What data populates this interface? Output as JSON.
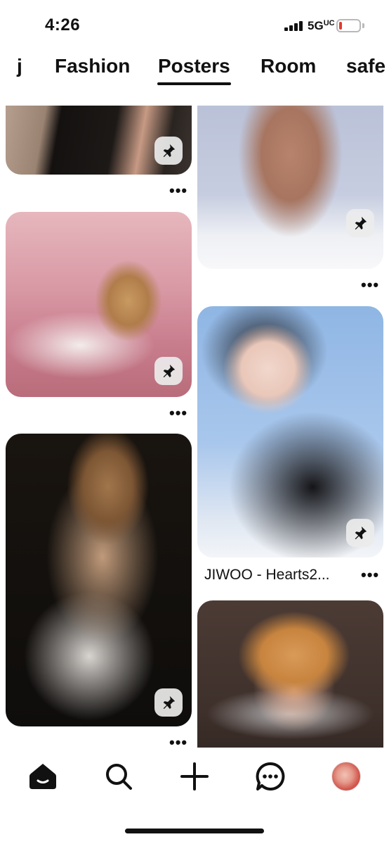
{
  "status_bar": {
    "time": "4:26",
    "network": "5G",
    "network_suffix": "UC",
    "battery_color": "#e43a31"
  },
  "tabs": {
    "items": [
      "j",
      "Fashion",
      "Posters",
      "Room",
      "safe"
    ],
    "active": "Posters"
  },
  "pins": [
    {
      "id": "pin-1",
      "column": "left",
      "has_save": true,
      "has_more": true
    },
    {
      "id": "pin-2",
      "column": "right",
      "has_save": true,
      "has_more": true
    },
    {
      "id": "pin-3",
      "column": "left",
      "has_save": true,
      "has_more": true
    },
    {
      "id": "pin-4",
      "column": "right",
      "title": "JIWOO - Hearts2...",
      "has_save": true,
      "has_more": true
    },
    {
      "id": "pin-5",
      "column": "left",
      "has_save": true,
      "has_more": true
    },
    {
      "id": "pin-6",
      "column": "right",
      "has_save": false,
      "has_more": false
    }
  ],
  "more_label": "•••",
  "nav": {
    "items": [
      "home-icon",
      "search-icon",
      "create-icon",
      "messages-icon",
      "profile-avatar"
    ],
    "active": "home-icon"
  },
  "colors": {
    "text": "#111111",
    "background": "#ffffff",
    "save_button": "#ebebeb"
  }
}
